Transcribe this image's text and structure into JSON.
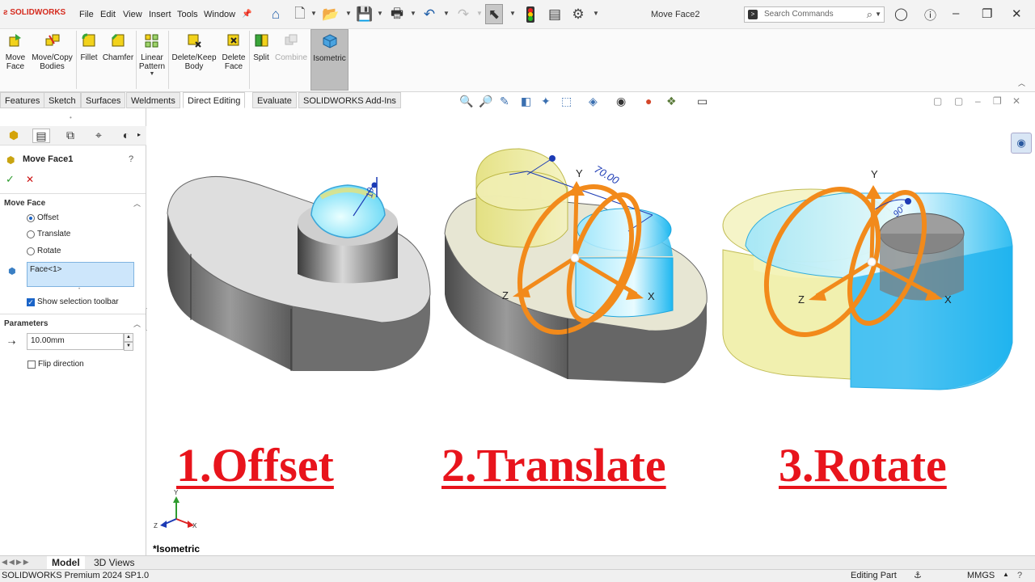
{
  "app": {
    "logo": "SOLIDWORKS",
    "document_title": "Move Face2"
  },
  "menu": [
    "File",
    "Edit",
    "View",
    "Insert",
    "Tools",
    "Window"
  ],
  "toolbar_icons": [
    "home-icon",
    "new-document-icon",
    "open-icon",
    "save-icon",
    "print-icon",
    "undo-icon",
    "redo-icon",
    "select-icon",
    "rebuild-icon",
    "file-properties-icon",
    "options-icon"
  ],
  "search": {
    "placeholder": "Search Commands"
  },
  "ribbon": {
    "buttons": [
      {
        "label1": "Move",
        "label2": "Face",
        "icon": "move-face-icon"
      },
      {
        "label1": "Move/Copy",
        "label2": "Bodies",
        "icon": "move-copy-bodies-icon"
      },
      {
        "label1": "Fillet",
        "label2": "",
        "icon": "fillet-icon"
      },
      {
        "label1": "Chamfer",
        "label2": "",
        "icon": "chamfer-icon"
      },
      {
        "label1": "Linear",
        "label2": "Pattern",
        "icon": "linear-pattern-icon"
      },
      {
        "label1": "Delete/Keep",
        "label2": "Body",
        "icon": "delete-keep-body-icon"
      },
      {
        "label1": "Delete",
        "label2": "Face",
        "icon": "delete-face-icon"
      },
      {
        "label1": "Split",
        "label2": "",
        "icon": "split-icon"
      },
      {
        "label1": "Combine",
        "label2": "",
        "icon": "combine-icon"
      },
      {
        "label1": "Isometric",
        "label2": "",
        "icon": "isometric-icon"
      }
    ]
  },
  "command_tabs": [
    "Features",
    "Sketch",
    "Surfaces",
    "Weldments",
    "Direct Editing",
    "Evaluate",
    "SOLIDWORKS Add-Ins"
  ],
  "active_tab": "Direct Editing",
  "property_manager": {
    "title": "Move Face1",
    "move_face_group": "Move Face",
    "options": [
      "Offset",
      "Translate",
      "Rotate"
    ],
    "selected_option": "Offset",
    "face_selection": "Face<1>",
    "show_selection_toolbar": "Show selection toolbar",
    "parameters_group": "Parameters",
    "distance": "10.00mm",
    "flip_direction": "Flip direction"
  },
  "viewport": {
    "view_name": "*Isometric",
    "captions": [
      "1.Offset",
      "2.Translate",
      "3.Rotate"
    ],
    "dimension_translate": "70.00",
    "dimension_offset": "10",
    "dimension_rotate": "90°",
    "axis_labels": {
      "x": "X",
      "y": "Y",
      "z": "Z"
    },
    "caption_color": "#e8141c",
    "triad_color": "#f28a1b",
    "highlight_color": "#38c8f5"
  },
  "bottom_tabs": [
    "Model",
    "3D Views"
  ],
  "status": {
    "product": "SOLIDWORKS Premium 2024 SP1.0",
    "mode": "Editing Part",
    "units": "MMGS"
  }
}
